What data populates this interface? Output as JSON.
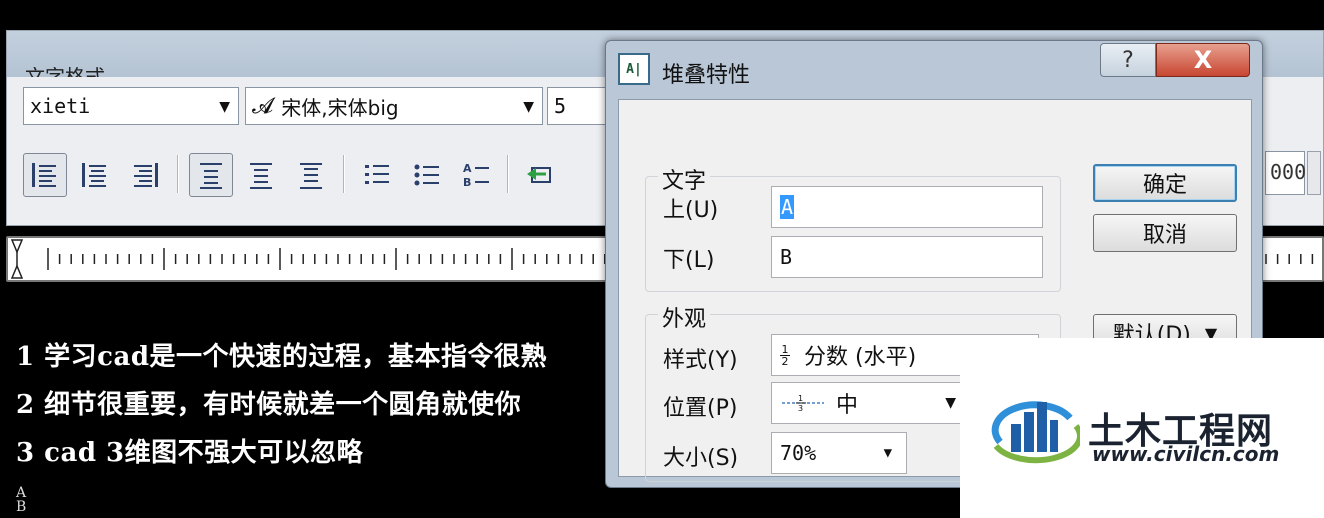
{
  "toolbar": {
    "title": "文字格式",
    "style_value": "xieti",
    "font_value": "宋体,宋体big",
    "height_value": "5",
    "right_field_value": "000"
  },
  "ruler": {
    "start_marker": ""
  },
  "editor": {
    "lines": [
      "1 学习cad是一个快速的过程，基本指令很熟",
      "2 细节很重要，有时候就差一个圆角就使你",
      "3 cad 3维图不强大可以忽略"
    ],
    "stack_top": "A",
    "stack_bottom": "B"
  },
  "dialog": {
    "title": "堆叠特性",
    "help_label": "?",
    "close_label": "X",
    "text_group": {
      "label": "文字",
      "upper_label": "上(U)",
      "upper_value": "A",
      "lower_label": "下(L)",
      "lower_value": "B"
    },
    "appearance_group": {
      "label": "外观",
      "style_label": "样式(Y)",
      "style_value": "分数 (水平)",
      "style_icon_num": "1",
      "style_icon_den": "2",
      "position_label": "位置(P)",
      "position_value": "中",
      "size_label": "大小(S)",
      "size_value": "70%"
    },
    "ok_label": "确定",
    "cancel_label": "取消",
    "default_label": "默认(D)"
  },
  "watermark": {
    "name": "土木工程网",
    "url": "www.civilcn.com"
  },
  "colors": {
    "close_button": "#c84631",
    "accent": "#3399ff",
    "background": "#000000"
  }
}
